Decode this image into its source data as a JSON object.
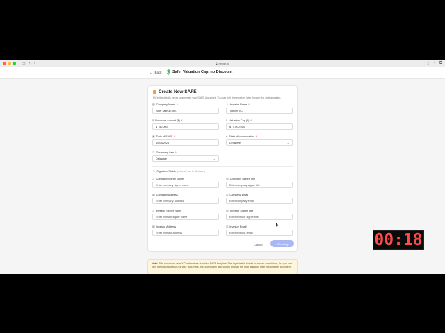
{
  "browser": {
    "url": "nexgn.ai",
    "colors": {
      "close": "#ff5f57",
      "min": "#febc2e",
      "max": "#28c840"
    }
  },
  "appbar": {
    "back_label": "Back",
    "doc_icon": "$",
    "doc_title": "Safe: Valuation Cap, no Discount"
  },
  "form": {
    "title": "Create New SAFE",
    "subtitle": "Fill in the details below to generate your SAFE document. You can edit these values later through the chat assistant.",
    "fields": {
      "company_name": {
        "label": "Company Name",
        "value": "Killer Startup, Inc."
      },
      "investor_name": {
        "label": "Investor Name",
        "value": "TopTier VC"
      },
      "purchase_amount": {
        "label": "Purchase Amount ($)",
        "prefix": "$",
        "value": "50,000"
      },
      "valuation_cap": {
        "label": "Valuation Cap ($)",
        "prefix": "$",
        "value": "5,000,000"
      },
      "date_of_safe": {
        "label": "Date of SAFE",
        "value": "10/03/2025"
      },
      "state_of_incorporation": {
        "label": "State of Incorporation",
        "value": "Delaware"
      },
      "governing_law": {
        "label": "Governing Law",
        "value": "Delaware"
      }
    },
    "signature": {
      "header": "Signature Fields",
      "header_note": "(optional - can be filled later)",
      "fields": {
        "company_signer_name": {
          "label": "Company Signer Name",
          "placeholder": "Enter company signer name"
        },
        "company_signer_title": {
          "label": "Company Signer Title",
          "placeholder": "Enter company signer title"
        },
        "company_address": {
          "label": "Company Address",
          "placeholder": "Enter company address"
        },
        "company_email": {
          "label": "Company Email",
          "placeholder": "Enter company email"
        },
        "investor_signer_name": {
          "label": "Investor Signer Name",
          "placeholder": "Enter investor signer name"
        },
        "investor_signer_title": {
          "label": "Investor Signer Title",
          "placeholder": "Enter investor signer title"
        },
        "investor_address": {
          "label": "Investor Address",
          "placeholder": "Enter investor address"
        },
        "investor_email": {
          "label": "Investor Email",
          "placeholder": "Enter investor email"
        }
      }
    },
    "cancel_label": "Cancel",
    "create_label": "Creating..."
  },
  "note": {
    "bold": "Note:",
    "text": "This document uses Y Combinator's standard SAFE template. The legal text is locked to ensure compliance, but you can fill in the specific details for your document. You can modify field values through the chat assistant after creating the document."
  },
  "timer": {
    "value": "00:18",
    "color": "#ff4a4a"
  }
}
